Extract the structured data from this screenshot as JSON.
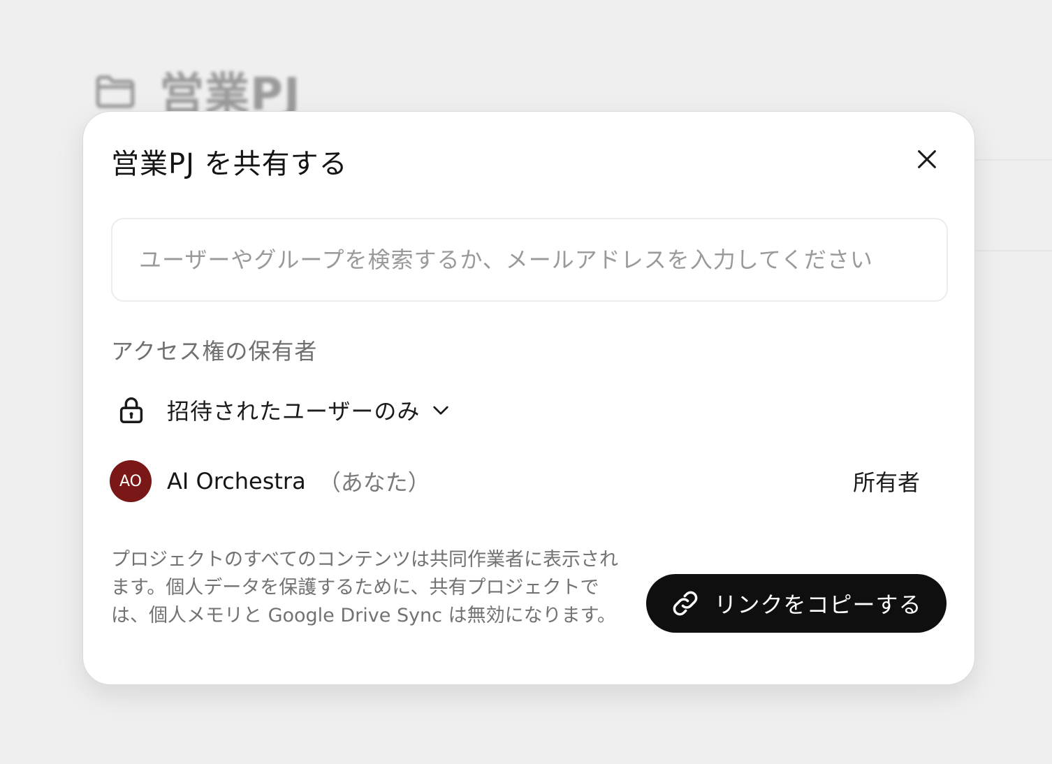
{
  "background": {
    "folder_icon": "folder-icon",
    "title": "営業PJ"
  },
  "dialog": {
    "title": "営業PJ を共有する",
    "close_icon": "close-icon",
    "search": {
      "placeholder": "ユーザーやグループを検索するか、メールアドレスを入力してください",
      "value": ""
    },
    "access_section_label": "アクセス権の保有者",
    "access_setting": {
      "icon": "lock-icon",
      "label": "招待されたユーザーのみ",
      "dropdown_icon": "chevron-down-icon"
    },
    "members": [
      {
        "initials": "AO",
        "name": "AI Orchestra",
        "suffix": "（あなた）",
        "role": "所有者",
        "avatar_color": "#7a1818"
      }
    ],
    "footer_note": "プロジェクトのすべてのコンテンツは共同作業者に表示されます。個人データを保護するために、共有プロジェクトでは、個人メモリと Google Drive Sync は無効になります。",
    "copy_link_button": {
      "icon": "link-icon",
      "label": "リンクをコピーする"
    }
  }
}
